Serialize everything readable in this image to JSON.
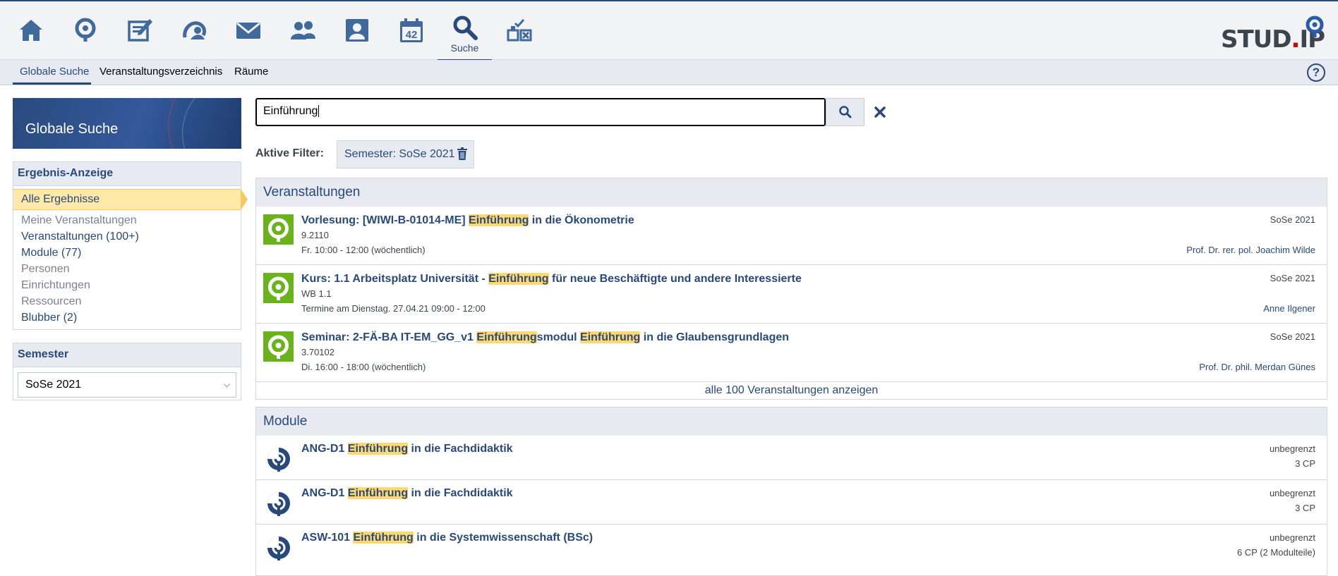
{
  "nav": {
    "icons": [
      "home-icon",
      "activity-icon",
      "courses-icon",
      "community-icon",
      "messages-icon",
      "contacts-icon",
      "profile-icon",
      "schedule-icon",
      "search-icon",
      "tools-icon"
    ],
    "calendar_number": "42",
    "active_label": "Suche",
    "logo_text_left": "STUD",
    "logo_dot": ".",
    "logo_text_right": "IP"
  },
  "subnav": {
    "items": [
      "Globale Suche",
      "Veranstaltungsverzeichnis",
      "Räume"
    ],
    "help": "?"
  },
  "sidebar": {
    "title": "Globale Suche",
    "results_heading": "Ergebnis-Anzeige",
    "results": [
      {
        "label": "Alle Ergebnisse",
        "state": "selected"
      },
      {
        "label": "Meine Veranstaltungen",
        "state": "disabled"
      },
      {
        "label": "Veranstaltungen (100+)",
        "state": "link"
      },
      {
        "label": "Module (77)",
        "state": "link"
      },
      {
        "label": "Personen",
        "state": "disabled"
      },
      {
        "label": "Einrichtungen",
        "state": "disabled"
      },
      {
        "label": "Ressourcen",
        "state": "disabled"
      },
      {
        "label": "Blubber (2)",
        "state": "link"
      }
    ],
    "semester_heading": "Semester",
    "semester_value": "SoSe 2021"
  },
  "search": {
    "query": "Einführung",
    "filter_label": "Aktive Filter:",
    "filter_chip": "Semester: SoSe 2021"
  },
  "courses": {
    "heading": "Veranstaltungen",
    "items": [
      {
        "title_parts": [
          {
            "text": "Vorlesung: [WIWI-B-01014-ME] ",
            "hl": false
          },
          {
            "text": "Einführung",
            "hl": true
          },
          {
            "text": " in die Ökonometrie",
            "hl": false
          }
        ],
        "number": "9.2110",
        "time": "Fr. 10:00 - 12:00 (wöchentlich)",
        "semester": "SoSe 2021",
        "lecturer": "Prof. Dr. rer. pol. Joachim Wilde"
      },
      {
        "title_parts": [
          {
            "text": "Kurs: 1.1 Arbeitsplatz Universität - ",
            "hl": false
          },
          {
            "text": "Einführung",
            "hl": true
          },
          {
            "text": " für neue Beschäftigte und andere Interessierte",
            "hl": false
          }
        ],
        "number": "WB 1.1",
        "time": "Termine am Dienstag. 27.04.21 09:00 - 12:00",
        "semester": "SoSe 2021",
        "lecturer": "Anne Ilgener"
      },
      {
        "title_parts": [
          {
            "text": "Seminar: 2-FÄ-BA IT-EM_GG_v1 ",
            "hl": false
          },
          {
            "text": "Einführung",
            "hl": true
          },
          {
            "text": "smodul ",
            "hl": false
          },
          {
            "text": "Einführung",
            "hl": true
          },
          {
            "text": " in die Glaubensgrundlagen",
            "hl": false
          }
        ],
        "number": "3.70102",
        "time": "Di. 16:00 - 18:00 (wöchentlich)",
        "semester": "SoSe 2021",
        "lecturer": "Prof. Dr. phil. Merdan Günes"
      }
    ],
    "show_all": "alle 100 Veranstaltungen anzeigen"
  },
  "modules": {
    "heading": "Module",
    "items": [
      {
        "title_parts": [
          {
            "text": "ANG-D1 ",
            "hl": false
          },
          {
            "text": "Einführung",
            "hl": true
          },
          {
            "text": " in die Fachdidaktik",
            "hl": false
          }
        ],
        "status": "unbegrenzt",
        "cp": "3 CP"
      },
      {
        "title_parts": [
          {
            "text": "ANG-D1 ",
            "hl": false
          },
          {
            "text": "Einführung",
            "hl": true
          },
          {
            "text": " in die Fachdidaktik",
            "hl": false
          }
        ],
        "status": "unbegrenzt",
        "cp": "3 CP"
      },
      {
        "title_parts": [
          {
            "text": "ASW-101 ",
            "hl": false
          },
          {
            "text": "Einführung",
            "hl": true
          },
          {
            "text": " in die Systemwissenschaft (BSc)",
            "hl": false
          }
        ],
        "status": "unbegrenzt",
        "cp": "6 CP (2 Modulteile)"
      }
    ]
  },
  "colors": {
    "brand": "#28497c",
    "highlight": "#ffd970",
    "selected_bg": "#ffe9a8",
    "course_avatar": "#6bb31d"
  }
}
